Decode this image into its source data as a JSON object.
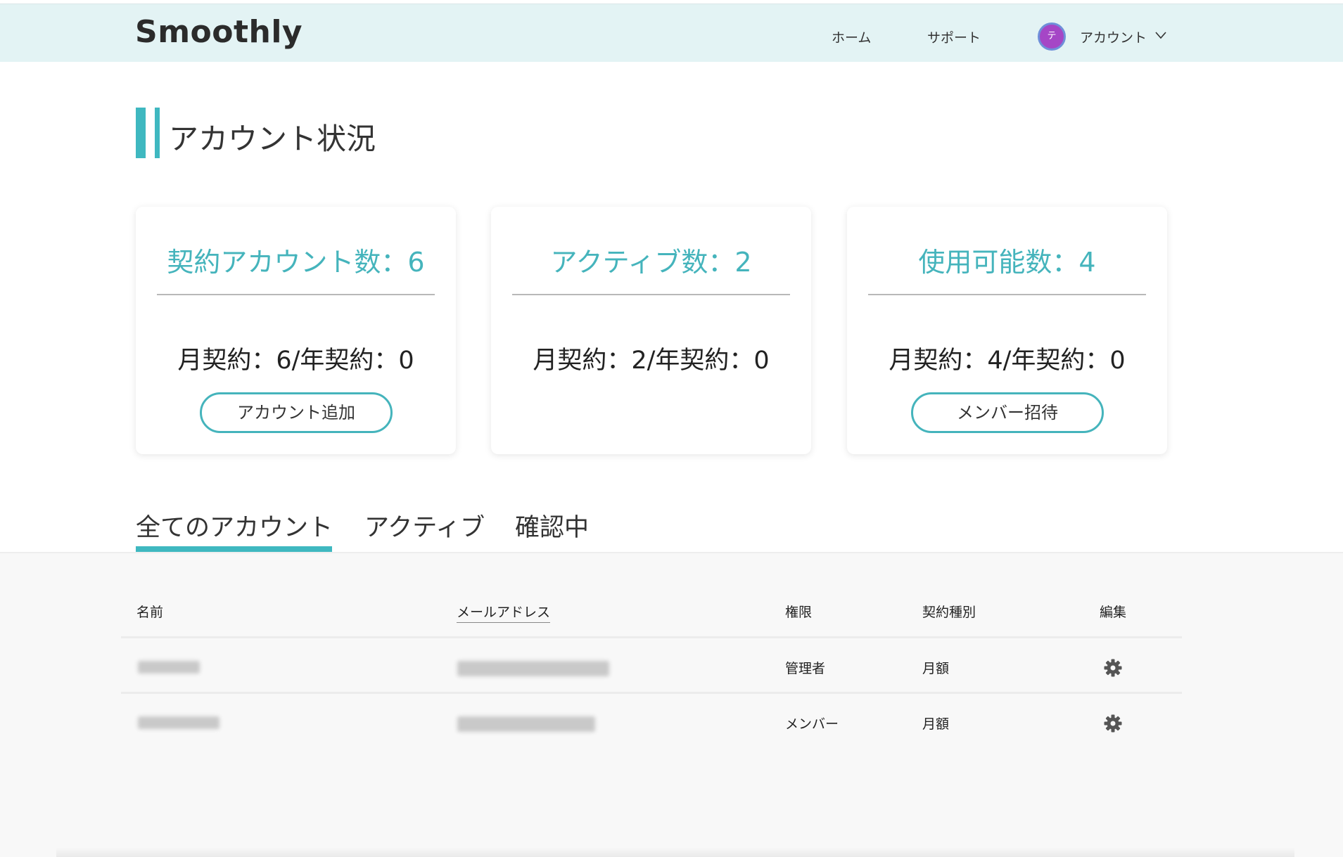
{
  "header": {
    "logo": "Smoothly",
    "nav": {
      "home": "ホーム",
      "support": "サポート",
      "account": "アカウント"
    },
    "avatar_initial": "テ",
    "avatar_color": "#a546c6"
  },
  "page_title": "アカウント状況",
  "cards": [
    {
      "title": "契約アカウント数：6",
      "sub": "月契約：6/年契約：0",
      "button": "アカウント追加"
    },
    {
      "title": "アクティブ数：2",
      "sub": "月契約：2/年契約：0"
    },
    {
      "title": "使用可能数：4",
      "sub": "月契約：4/年契約：0",
      "button": "メンバー招待"
    }
  ],
  "tabs": {
    "all": "全てのアカウント",
    "active": "アクティブ",
    "pending": "確認中",
    "selected": "all"
  },
  "table": {
    "headers": {
      "name": "名前",
      "email": "メールアドレス",
      "role": "権限",
      "plan": "契約種別",
      "edit": "編集"
    },
    "rows": [
      {
        "role": "管理者",
        "plan": "月額"
      },
      {
        "role": "メンバー",
        "plan": "月額"
      }
    ]
  },
  "colors": {
    "accent": "#3fb8c0",
    "header_bg": "#e3f3f4",
    "card_title": "#45b4bc"
  },
  "icons": {
    "dropdown": "chevron-down-icon",
    "edit": "gear-icon"
  }
}
